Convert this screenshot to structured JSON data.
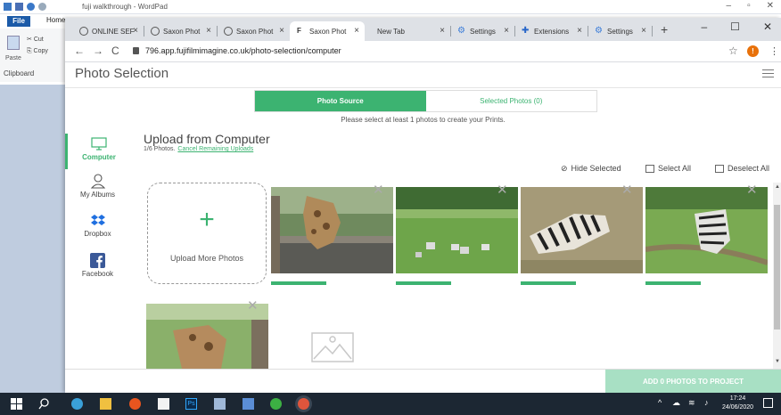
{
  "wordpad": {
    "title": "fuji walkthrough - WordPad",
    "file_tab": "File",
    "home_tab": "Home",
    "cut": "Cut",
    "copy": "Copy",
    "paste": "Paste",
    "clipboard": "Clipboard"
  },
  "browser": {
    "tabs": [
      {
        "label": "ONLINE SEF",
        "icon": "globe-icon"
      },
      {
        "label": "Saxon Phot",
        "icon": "globe-icon"
      },
      {
        "label": "Saxon Phot",
        "icon": "globe-icon"
      },
      {
        "label": "Saxon Phot",
        "icon": "fujifilm-icon"
      },
      {
        "label": "New Tab",
        "icon": ""
      },
      {
        "label": "Settings",
        "icon": "gear-icon"
      },
      {
        "label": "Extensions",
        "icon": "puzzle-icon"
      },
      {
        "label": "Settings",
        "icon": "gear-icon"
      }
    ],
    "active_tab": 3,
    "url": "796.app.fujifilmimagine.co.uk/photo-selection/computer",
    "profile_initial": "!"
  },
  "page": {
    "title": "Photo Selection",
    "steps": [
      "Photo Source",
      "Selected Photos (0)"
    ],
    "notice": "Please select at least 1 photos to create your Prints.",
    "sources": [
      "Computer",
      "My Albums",
      "Dropbox",
      "Facebook"
    ],
    "upload_title": "Upload from Computer",
    "upload_count": "1/6 Photos.",
    "cancel_link": "Cancel Remaining Uploads",
    "hide_selected": "Hide Selected",
    "select_all": "Select All",
    "deselect_all": "Deselect All",
    "upload_more": "Upload More Photos",
    "add_button": "ADD 0 PHOTOS TO PROJECT",
    "accent": "#3cb371"
  },
  "taskbar": {
    "time": "17:24",
    "date": "24/06/2020"
  }
}
